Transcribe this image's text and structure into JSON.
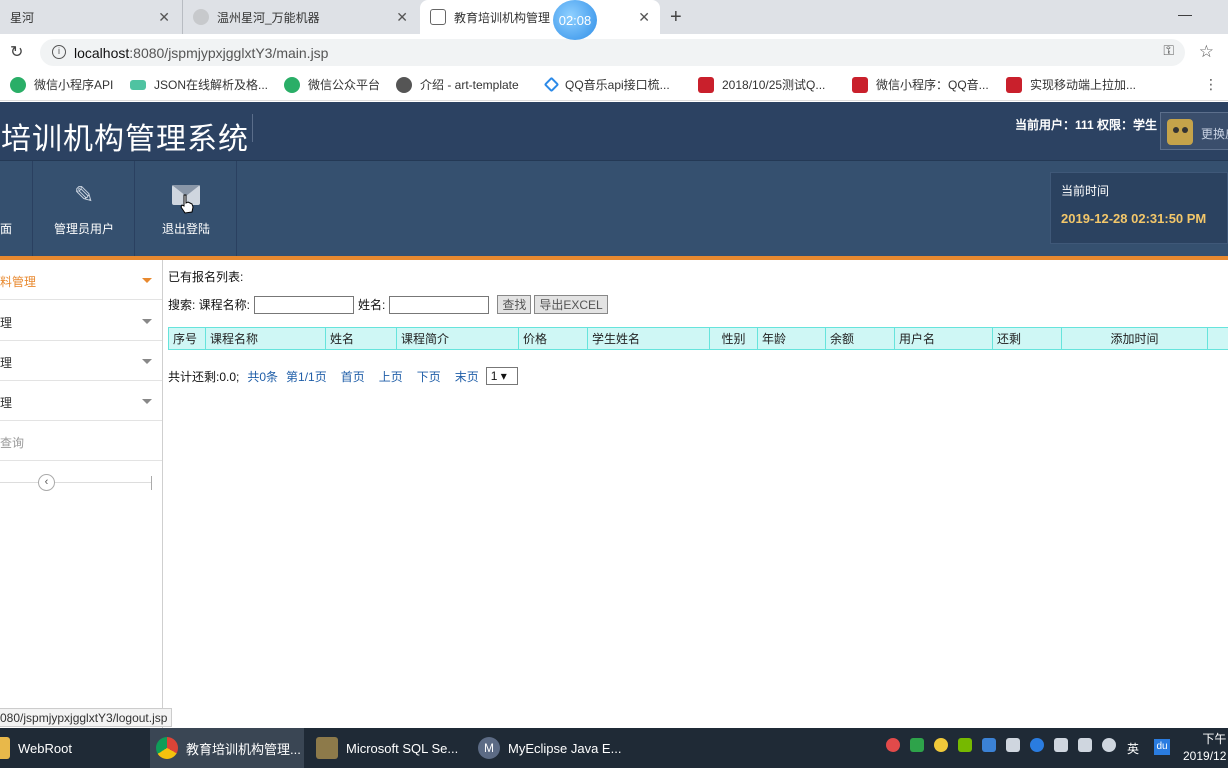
{
  "browser": {
    "tabs": [
      {
        "title": "星河",
        "close": "✕"
      },
      {
        "title": "温州星河_万能机器",
        "close": "✕"
      },
      {
        "title": "教育培训机构管理",
        "close": "✕"
      }
    ],
    "new_tab": "+",
    "window_min": "—",
    "recording_timer": "02:08",
    "url_host": "localhost",
    "url_rest": ":8080/jspmjypxjgglxtY3/main.jsp",
    "bookmarks": [
      {
        "label": "微信小程序API",
        "icon": "wechat-icon"
      },
      {
        "label": "JSON在线解析及格...",
        "icon": "json-icon"
      },
      {
        "label": "微信公众平台",
        "icon": "wechat-icon"
      },
      {
        "label": "介绍 - art-template",
        "icon": "globe-icon"
      },
      {
        "label": "QQ音乐api接口梳...",
        "icon": "qqmusic-icon"
      },
      {
        "label": "2018/10/25测试Q...",
        "icon": "csdn-icon"
      },
      {
        "label": "微信小程序：QQ音...",
        "icon": "csdn-icon"
      },
      {
        "label": "实现移动端上拉加...",
        "icon": "csdn-icon"
      }
    ],
    "status_url": "080/jspmjypxjgglxtY3/logout.jsp"
  },
  "header": {
    "title": "育培训机构管理系统",
    "user_info": "当前用户：111 权限：学生",
    "change_skin": "更换皮肤"
  },
  "nav": {
    "home_label": "面",
    "admin_label": "管理员用户",
    "logout_label": "退出登陆",
    "time_label": "当前时间",
    "time_value": "2019-12-28 02:31:50 PM"
  },
  "sidebar": {
    "items": [
      {
        "label": "料管理"
      },
      {
        "label": "理"
      },
      {
        "label": "理"
      },
      {
        "label": "理"
      },
      {
        "label": "查询"
      }
    ],
    "collapse": "‹"
  },
  "main": {
    "list_title": "已有报名列表:",
    "search_label": "搜索: 课程名称:",
    "name_label": "姓名:",
    "search_button": "查找",
    "export_button": "导出EXCEL",
    "columns": [
      "序号",
      "课程名称",
      "姓名",
      "课程简介",
      "价格",
      "学生姓名",
      "性别",
      "年龄",
      "余额",
      "用户名",
      "还剩",
      "添加时间"
    ],
    "pager": {
      "total_remaining": "共计还剩:0.0;",
      "count": "共0条",
      "page": "第1/1页",
      "first": "首页",
      "prev": "上页",
      "next": "下页",
      "last": "末页",
      "select_value": "1 ▾"
    }
  },
  "taskbar": {
    "tasks": [
      {
        "label": "WebRoot"
      },
      {
        "label": "教育培训机构管理..."
      },
      {
        "label": "Microsoft SQL Se..."
      },
      {
        "label": "MyEclipse Java E..."
      }
    ],
    "lang": "英",
    "du": "du",
    "clock_top": "下午",
    "clock_bottom": "2019/12"
  }
}
